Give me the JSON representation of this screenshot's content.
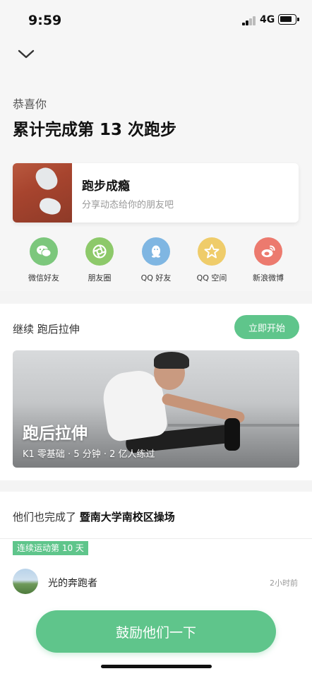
{
  "status_bar": {
    "time": "9:59",
    "network": "4G"
  },
  "header": {
    "congrats": "恭喜你",
    "headline": "累计完成第 13 次跑步"
  },
  "share_card": {
    "title": "跑步成瘾",
    "subtitle": "分享动态给你的朋友吧"
  },
  "share_targets": [
    {
      "label": "微信好友",
      "icon": "wechat-icon",
      "color": "#7cc77c"
    },
    {
      "label": "朋友圈",
      "icon": "moments-icon",
      "color": "#8dc96a"
    },
    {
      "label": "QQ 好友",
      "icon": "qq-icon",
      "color": "#7fb6e2"
    },
    {
      "label": "QQ 空间",
      "icon": "qzone-icon",
      "color": "#efcc6a"
    },
    {
      "label": "新浪微博",
      "icon": "weibo-icon",
      "color": "#ec7a6e"
    }
  ],
  "continue_section": {
    "label": "继续 跑后拉伸",
    "start_label": "立即开始",
    "course_title": "跑后拉伸",
    "course_meta": "K1 零基础 · 5 分钟 · 2 亿人练过"
  },
  "others_section": {
    "prefix": "他们也完成了",
    "location": "暨南大学南校区操场",
    "streak": "连续运动第 10 天",
    "user_name": "光的奔跑者",
    "time_ago": "2小时前"
  },
  "cheer_button": "鼓励他们一下",
  "colors": {
    "accent": "#5fc58b",
    "background": "#f6f6f6"
  }
}
